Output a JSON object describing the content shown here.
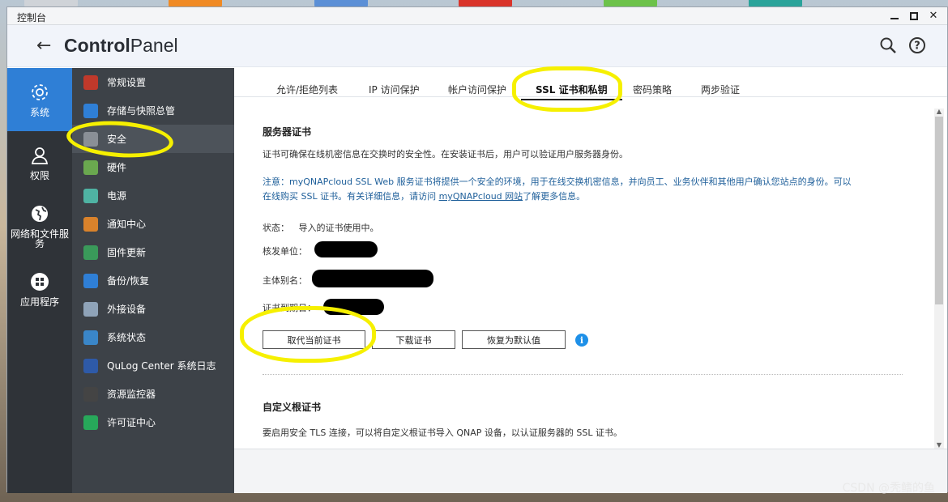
{
  "window": {
    "title": "控制台"
  },
  "header": {
    "app_title_bold": "Control",
    "app_title_rest": "Panel"
  },
  "nav_main": [
    {
      "label": "系统",
      "icon": "gear-icon",
      "active": true
    },
    {
      "label": "权限",
      "icon": "user-icon",
      "active": false
    },
    {
      "label": "网络和文件服务",
      "icon": "globe-icon",
      "active": false
    },
    {
      "label": "应用程序",
      "icon": "apps-icon",
      "active": false
    }
  ],
  "nav_sub": [
    {
      "label": "常规设置",
      "icon": "settings-icon",
      "color": "#c0392b"
    },
    {
      "label": "存储与快照总管",
      "icon": "storage-icon",
      "color": "#2f7fd6"
    },
    {
      "label": "安全",
      "icon": "lock-icon",
      "color": "#8a8f96",
      "active": true
    },
    {
      "label": "硬件",
      "icon": "hardware-icon",
      "color": "#6aa84f"
    },
    {
      "label": "电源",
      "icon": "power-icon",
      "color": "#4fb3a3"
    },
    {
      "label": "通知中心",
      "icon": "notification-icon",
      "color": "#d9822b"
    },
    {
      "label": "固件更新",
      "icon": "firmware-icon",
      "color": "#3a9a5a"
    },
    {
      "label": "备份/恢复",
      "icon": "backup-icon",
      "color": "#2f7fd6"
    },
    {
      "label": "外接设备",
      "icon": "external-device-icon",
      "color": "#8fa3b8"
    },
    {
      "label": "系统状态",
      "icon": "monitor-icon",
      "color": "#3a86c8"
    },
    {
      "label": "QuLog Center 系统日志",
      "icon": "qulog-icon",
      "color": "#2e5aa8"
    },
    {
      "label": "资源监控器",
      "icon": "resource-monitor-icon",
      "color": "#444444"
    },
    {
      "label": "许可证中心",
      "icon": "license-icon",
      "color": "#27a85a"
    }
  ],
  "tabs": [
    {
      "label": "允许/拒绝列表",
      "active": false
    },
    {
      "label": "IP 访问保护",
      "active": false
    },
    {
      "label": "帐户访问保护",
      "active": false
    },
    {
      "label": "SSL 证书和私钥",
      "active": true
    },
    {
      "label": "密码策略",
      "active": false
    },
    {
      "label": "两步验证",
      "active": false
    }
  ],
  "server_cert": {
    "title": "服务器证书",
    "description": "证书可确保在线机密信息在交换时的安全性。在安装证书后，用户可以验证用户服务器身份。",
    "note_part1": "注意：myQNAPcloud SSL Web 服务证书将提供一个安全的环境，用于在线交换机密信息，并向员工、业务伙伴和其他用户确认您站点的身份。可以",
    "note_part2": "在线购买 SSL 证书。有关详细信息，请访问 ",
    "note_link": "myQNAPcloud 网站",
    "note_part3": "了解更多信息。",
    "status_label": "状态：",
    "status_value": "导入的证书使用中。",
    "issuer_label": "核发单位：",
    "subject_label": "主体别名：",
    "expiry_label": "证书到期日："
  },
  "buttons": {
    "replace": "取代当前证书",
    "download": "下载证书",
    "restore": "恢复为默认值"
  },
  "custom_root": {
    "title": "自定义根证书",
    "description": "要启用安全 TLS 连接，可以将自定义根证书导入 QNAP 设备，以认证服务器的 SSL 证书。"
  },
  "watermark": "CSDN @秃鳍的鱼"
}
